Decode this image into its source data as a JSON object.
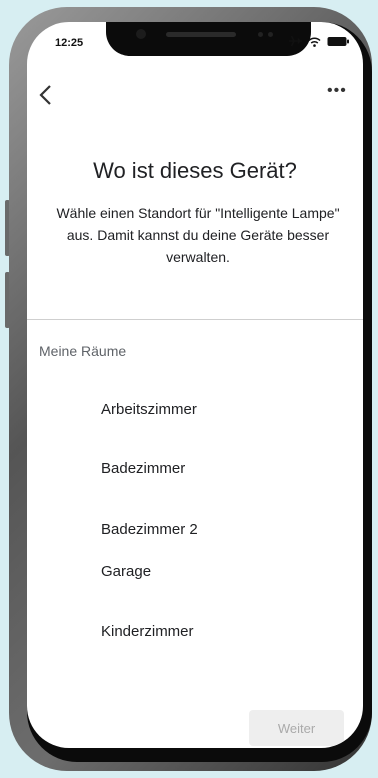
{
  "status_bar": {
    "time": "12:25"
  },
  "header": {
    "back_icon": "chevron-left-icon",
    "more_label": "•••"
  },
  "main": {
    "title": "Wo ist dieses Gerät?",
    "description": "Wähle einen Standort für \"Intelligente Lampe\" aus. Damit kannst du deine Geräte besser verwalten."
  },
  "rooms_section": {
    "heading": "Meine Räume",
    "items": [
      {
        "label": "Arbeitszimmer"
      },
      {
        "label": "Badezimmer"
      },
      {
        "label": "Badezimmer 2"
      },
      {
        "label": "Garage"
      },
      {
        "label": "Kinderzimmer"
      }
    ]
  },
  "footer": {
    "next_label": "Weiter"
  },
  "colors": {
    "background": "#d7eef2",
    "frame": "#555555",
    "text": "#202124",
    "muted": "#5f6368",
    "button_disabled": "#eeeeee"
  }
}
